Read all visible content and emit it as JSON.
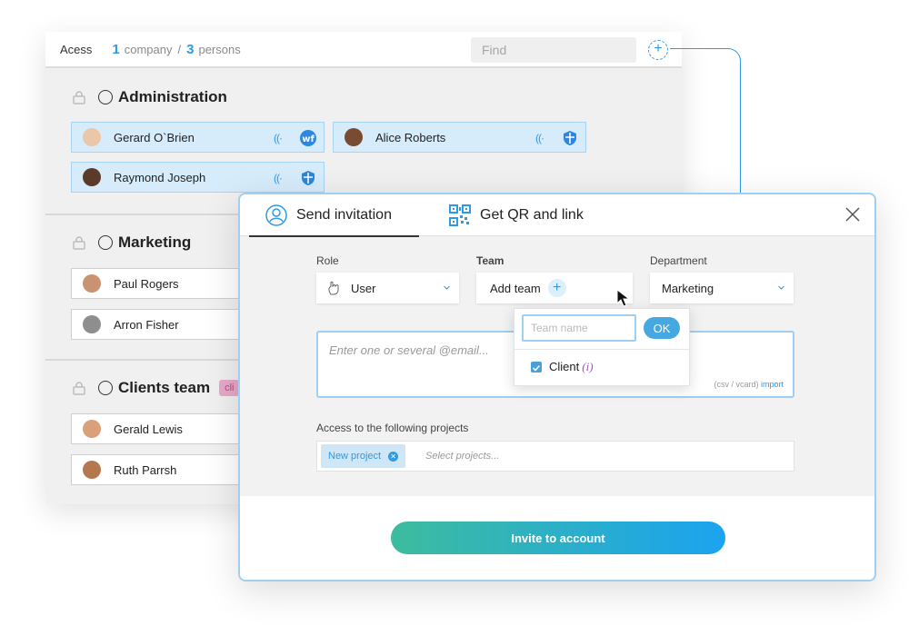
{
  "access": {
    "title": "Acess",
    "company_count": "1",
    "company_label": "company",
    "separator": "/",
    "person_count": "3",
    "person_label": "persons",
    "find_placeholder": "Find"
  },
  "groups": [
    {
      "name": "Administration",
      "members": [
        {
          "name": "Gerard O`Brien",
          "badge": "wf-icon"
        },
        {
          "name": "Alice Roberts",
          "badge": "shield-icon"
        },
        {
          "name": "Raymond Joseph",
          "badge": "shield-icon"
        }
      ]
    },
    {
      "name": "Marketing",
      "members": [
        {
          "name": "Paul Rogers"
        },
        {
          "name": "Arron Fisher"
        }
      ]
    },
    {
      "name": "Clients team",
      "tag": "cli",
      "members": [
        {
          "name": "Gerald Lewis"
        },
        {
          "name": "Ruth Parrsh"
        }
      ]
    }
  ],
  "modal": {
    "tabs": [
      {
        "label": "Send invitation",
        "icon": "user-icon",
        "active": true
      },
      {
        "label": "Get QR and link",
        "icon": "qr-code-icon",
        "active": false
      }
    ],
    "role_label": "Role",
    "role_value": "User",
    "team_label": "Team",
    "team_value": "Add team",
    "department_label": "Department",
    "department_value": "Marketing",
    "email_placeholder": "Enter one or several @email...",
    "import_note": "(csv / vcard)",
    "import_link": "import",
    "projects_label": "Access to the following projects",
    "project_chip": "New project",
    "projects_placeholder": "Select projects...",
    "invite_button": "Invite to account"
  },
  "team_popover": {
    "input_placeholder": "Team name",
    "ok_label": "OK",
    "option_label": "Client",
    "option_info": "(i)",
    "option_checked": true
  },
  "colors": {
    "accent": "#2e9ae6",
    "selected_row": "#d7ecfb",
    "gradient_start": "#3dbc9e",
    "gradient_end": "#1ba3f0",
    "tag": "#e8a8c8"
  }
}
